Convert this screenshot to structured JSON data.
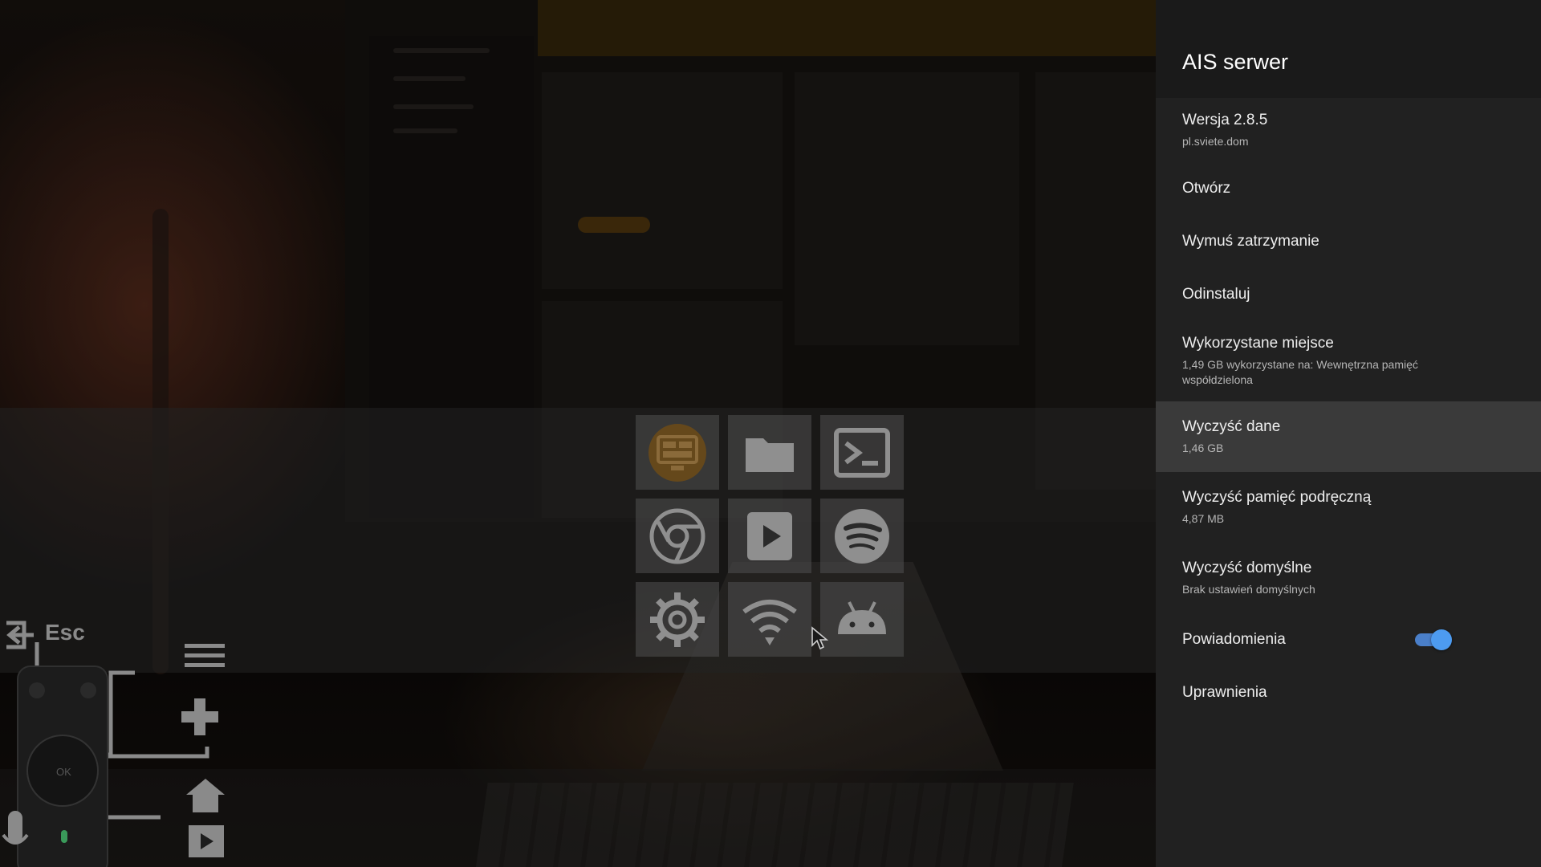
{
  "launcher": {
    "apps": [
      {
        "name": "dashboard-app-icon",
        "icon": "monitor-dashboard"
      },
      {
        "name": "files-app-icon",
        "icon": "folder"
      },
      {
        "name": "terminal-app-icon",
        "icon": "terminal"
      },
      {
        "name": "browser-app-icon",
        "icon": "chrome"
      },
      {
        "name": "player-app-icon",
        "icon": "play"
      },
      {
        "name": "spotify-app-icon",
        "icon": "spotify"
      },
      {
        "name": "settings-app-icon",
        "icon": "gear"
      },
      {
        "name": "wifi-app-icon",
        "icon": "wifi"
      },
      {
        "name": "android-app-icon",
        "icon": "android"
      }
    ]
  },
  "remote_hint": {
    "esc_label": "Esc"
  },
  "panel": {
    "title": "AIS serwer",
    "version_label": "Wersja 2.8.5",
    "version_sub": "pl.sviete.dom",
    "open_label": "Otwórz",
    "force_stop_label": "Wymuś zatrzymanie",
    "uninstall_label": "Odinstaluj",
    "storage_label": "Wykorzystane miejsce",
    "storage_sub": "1,49 GB wykorzystane na: Wewnętrzna pamięć współdzielona",
    "clear_data_label": "Wyczyść dane",
    "clear_data_sub": "1,46 GB",
    "clear_cache_label": "Wyczyść pamięć podręczną",
    "clear_cache_sub": "4,87 MB",
    "clear_defaults_label": "Wyczyść domyślne",
    "clear_defaults_sub": "Brak ustawień domyślnych",
    "notifications_label": "Powiadomienia",
    "notifications_enabled": true,
    "permissions_label": "Uprawnienia",
    "accent_color": "#4d9bf0"
  }
}
